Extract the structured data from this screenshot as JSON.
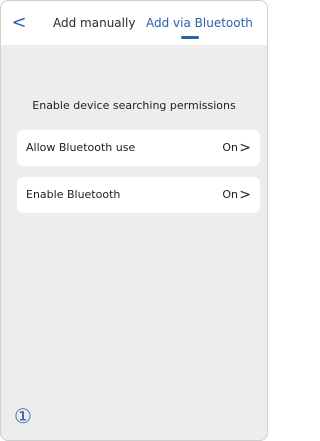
{
  "header": {
    "back_icon": "chevron-left-icon",
    "tabs": [
      {
        "label": "Add manually",
        "active": false
      },
      {
        "label": "Add via Bluetooth",
        "active": true
      }
    ]
  },
  "section": {
    "title": "Enable device searching permissions"
  },
  "permissions": [
    {
      "label": "Allow Bluetooth use",
      "value": "On"
    },
    {
      "label": "Enable Bluetooth",
      "value": "On"
    }
  ],
  "step_marker": "①",
  "colors": {
    "accent": "#2b61ad",
    "background": "#ededed",
    "card": "#ffffff"
  }
}
